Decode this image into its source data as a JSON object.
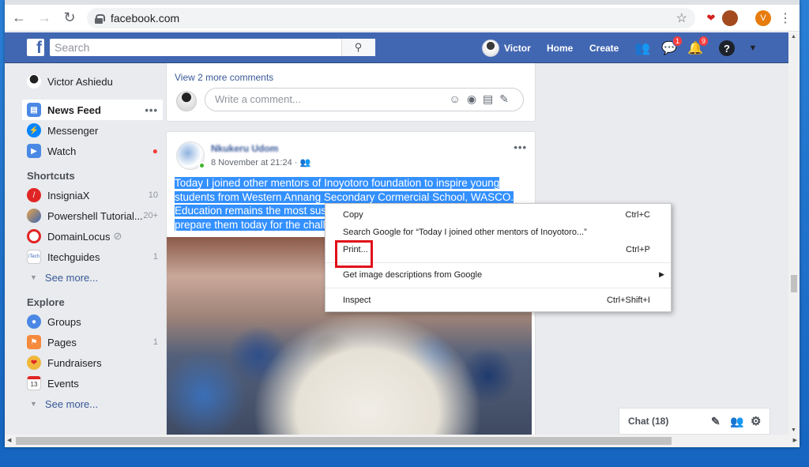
{
  "browser": {
    "url": "facebook.com",
    "profile_initial": "V"
  },
  "topbar": {
    "search_placeholder": "Search",
    "user_name": "Victor",
    "home_label": "Home",
    "create_label": "Create",
    "messenger_badge": "1",
    "notif_badge": "9",
    "help_label": "?"
  },
  "left_nav": {
    "profile_name": "Victor Ashiedu",
    "items": [
      {
        "label": "News Feed"
      },
      {
        "label": "Messenger"
      },
      {
        "label": "Watch"
      }
    ],
    "shortcuts_header": "Shortcuts",
    "shortcuts": [
      {
        "label": "InsigniaX",
        "count": "10"
      },
      {
        "label": "Powershell Tutorial...",
        "count": "20+"
      },
      {
        "label": "DomainLocus",
        "count": ""
      },
      {
        "label": "Itechguides",
        "count": "1"
      }
    ],
    "see_more_1": "See more...",
    "explore_header": "Explore",
    "explore": [
      {
        "label": "Groups",
        "count": ""
      },
      {
        "label": "Pages",
        "count": "1"
      },
      {
        "label": "Fundraisers",
        "count": ""
      },
      {
        "label": "Events",
        "count": ""
      }
    ],
    "see_more_2": "See more..."
  },
  "comments_card": {
    "view_more": "View 2 more comments",
    "comment_placeholder": "Write a comment..."
  },
  "post": {
    "author": "Nkukeru Udom",
    "timestamp": "8 November at 21:24 ·",
    "text_lines": [
      "Today I joined other mentors of Inoyotoro foundation to inspire young",
      "students from Western Annang Secondary Cormercial School, WASCO.",
      "Education remains the most susta",
      "prepare them today for the challe"
    ]
  },
  "context_menu": {
    "copy": "Copy",
    "copy_shortcut": "Ctrl+C",
    "search_google": "Search Google for “Today I joined other mentors of Inoyotoro...”",
    "print": "Print...",
    "print_shortcut": "Ctrl+P",
    "image_desc": "Get image descriptions from Google",
    "inspect": "Inspect",
    "inspect_shortcut": "Ctrl+Shift+I"
  },
  "chat": {
    "label": "Chat (18)"
  },
  "colors": {
    "fb_blue": "#4267b2",
    "selection": "#3390ff",
    "highlight_box": "#e0101a"
  }
}
